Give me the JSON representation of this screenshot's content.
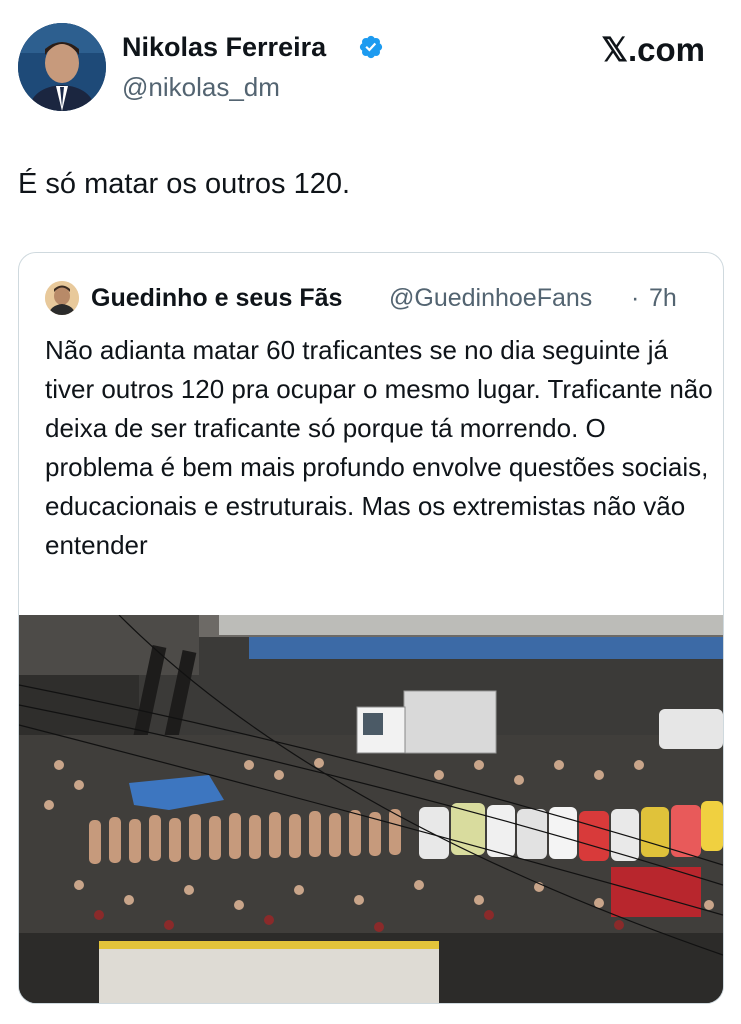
{
  "author": {
    "name": "Nikolas Ferreira",
    "handle": "@nikolas_dm",
    "verified": true,
    "verified_icon": "verified-badge-icon"
  },
  "brand": "𝕏.com",
  "tweet": {
    "text": "É só matar os outros 120."
  },
  "quoted": {
    "name": "Guedinho e seus Fãs",
    "handle": "@GuedinhoeFans",
    "separator": "·",
    "time": "7h",
    "text": "Não adianta matar 60 traficantes se no dia seguinte já tiver outros 120 pra ocupar o mesmo lugar. Traficante não deixa de ser traficante só porque tá morrendo. O problema é bem mais profundo envolve questões sociais, educacionais e estruturais. Mas os extremistas não vão entender",
    "media": "aerial-street-photo"
  },
  "colors": {
    "text": "#0f1419",
    "secondary": "#536471",
    "verified": "#1d9bf0",
    "border": "#cfd9de"
  }
}
